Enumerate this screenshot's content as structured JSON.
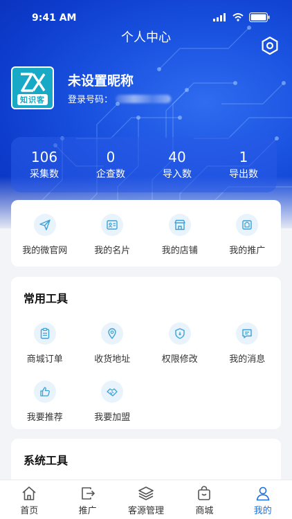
{
  "status_bar": {
    "time": "9:41 AM"
  },
  "header": {
    "title": "个人中心"
  },
  "profile": {
    "logo_text": "知识客",
    "nickname": "未设置昵称",
    "login_label": "登录号码："
  },
  "stats": [
    {
      "value": "106",
      "label": "采集数"
    },
    {
      "value": "0",
      "label": "企查数"
    },
    {
      "value": "40",
      "label": "导入数"
    },
    {
      "value": "1",
      "label": "导出数"
    }
  ],
  "quick_links": [
    {
      "label": "我的微官网",
      "icon": "paper-plane-icon"
    },
    {
      "label": "我的名片",
      "icon": "id-card-icon"
    },
    {
      "label": "我的店铺",
      "icon": "store-icon"
    },
    {
      "label": "我的推广",
      "icon": "promotion-icon"
    }
  ],
  "common_tools": {
    "title": "常用工具",
    "items": [
      {
        "label": "商城订单",
        "icon": "clipboard-icon"
      },
      {
        "label": "收货地址",
        "icon": "location-pin-icon"
      },
      {
        "label": "权限修改",
        "icon": "shield-icon"
      },
      {
        "label": "我的消息",
        "icon": "message-icon"
      },
      {
        "label": "我要推荐",
        "icon": "thumbs-up-icon"
      },
      {
        "label": "我要加盟",
        "icon": "handshake-icon"
      }
    ]
  },
  "system_tools": {
    "title": "系统工具"
  },
  "tabbar": [
    {
      "label": "首页",
      "icon": "home-icon"
    },
    {
      "label": "推广",
      "icon": "share-icon"
    },
    {
      "label": "客源管理",
      "icon": "layers-icon"
    },
    {
      "label": "商城",
      "icon": "shopping-bag-icon"
    },
    {
      "label": "我的",
      "icon": "person-icon",
      "active": true
    }
  ],
  "colors": {
    "hero_blue": "#1a52e0",
    "accent_blue": "#1a6fe0",
    "icon_bg": "#e8f3fb",
    "logo_teal": "#17a9c6"
  }
}
